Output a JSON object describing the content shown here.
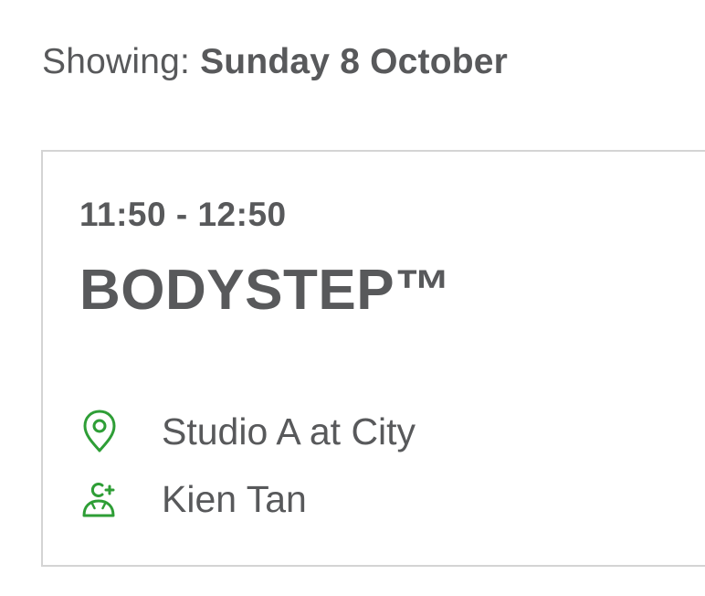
{
  "header": {
    "prefix": "Showing:",
    "date": "Sunday 8 October"
  },
  "class_card": {
    "time": "11:50 - 12:50",
    "title": "BODYSTEP™",
    "location": {
      "icon": "location-pin-icon",
      "text": "Studio A at City"
    },
    "instructor": {
      "icon": "instructor-icon",
      "text": "Kien Tan"
    }
  },
  "colors": {
    "text": "#58595b",
    "icon_accent": "#2e9e36",
    "card_border": "#d4d4d4",
    "background": "#ffffff"
  }
}
